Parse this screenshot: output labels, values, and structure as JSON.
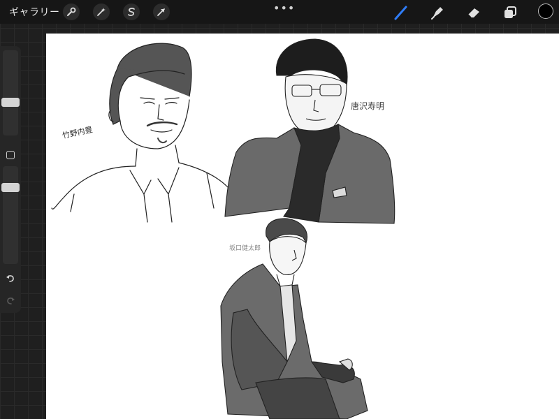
{
  "toolbar": {
    "gallery_label": "ギャラリー",
    "left_icons": [
      "wrench-icon",
      "magic-wand-icon",
      "selection-s-icon",
      "transform-arrow-icon"
    ],
    "right_icons": [
      "brush-icon",
      "smudge-icon",
      "eraser-icon",
      "layers-icon"
    ],
    "active_tool": "brush",
    "current_color": "#000000",
    "accent_color": "#2f7cf6"
  },
  "sidebar": {
    "brush_size_level": 0.38,
    "opacity_level": 0.4,
    "undo_icon": "undo-icon",
    "redo_icon": "redo-icon"
  },
  "canvas": {
    "labels": {
      "sketch1": "竹野内豊",
      "sketch2": "唐沢寿明",
      "sketch3": "坂口健太郎"
    }
  }
}
